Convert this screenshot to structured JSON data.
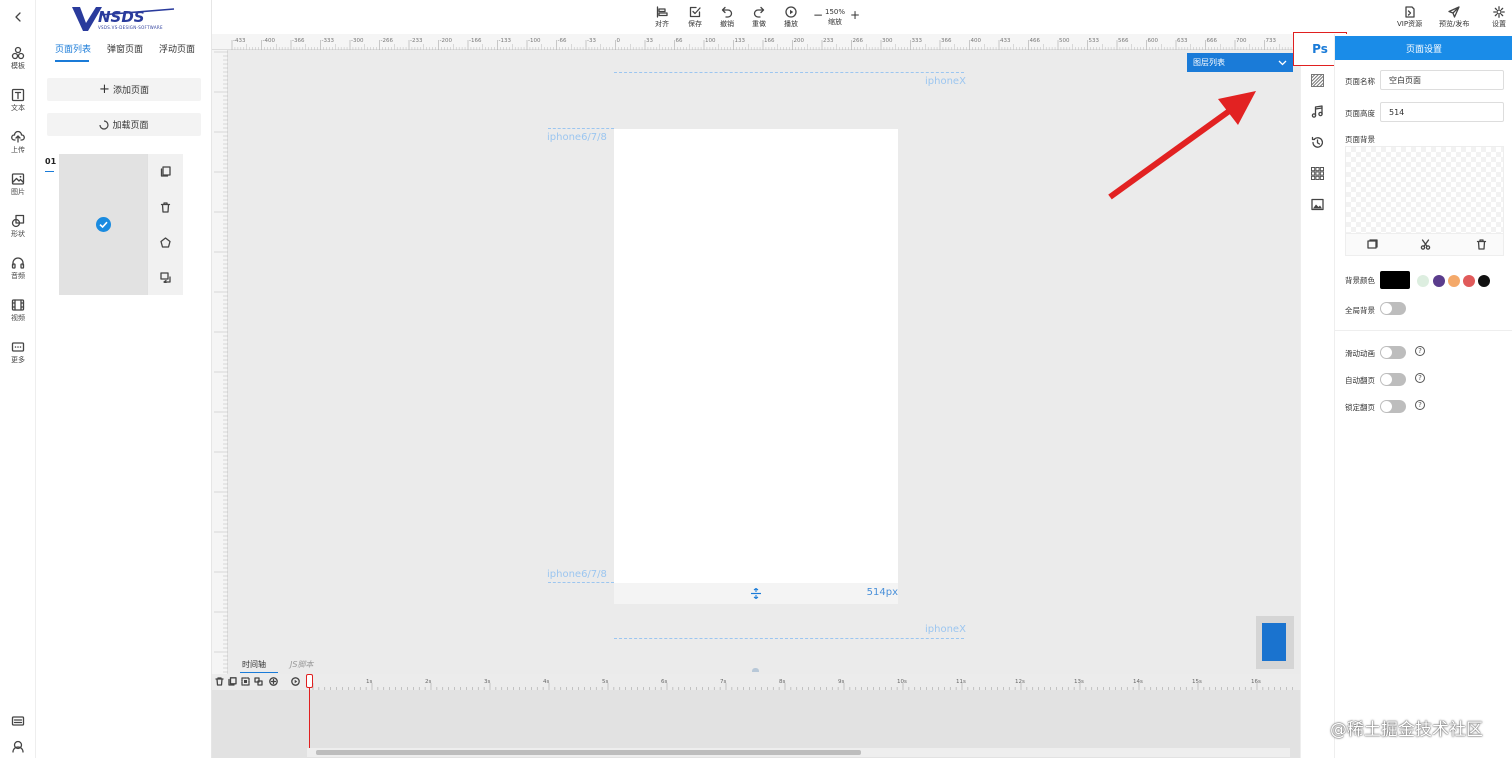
{
  "logo": {
    "text": "VNSDS",
    "subtext": "VSDS.VS-DESIGN-SOFTWARE"
  },
  "left_toolbar": {
    "items": [
      {
        "label": "模板",
        "icon": "template-icon"
      },
      {
        "label": "文本",
        "icon": "text-icon"
      },
      {
        "label": "上传",
        "icon": "upload-icon"
      },
      {
        "label": "图片",
        "icon": "image-icon"
      },
      {
        "label": "形状",
        "icon": "shape-icon"
      },
      {
        "label": "音频",
        "icon": "audio-icon"
      },
      {
        "label": "视频",
        "icon": "video-icon"
      },
      {
        "label": "更多",
        "icon": "more-icon"
      }
    ]
  },
  "page_panel": {
    "tabs": [
      {
        "label": "页面列表",
        "active": true
      },
      {
        "label": "弹窗页面"
      },
      {
        "label": "浮动页面"
      }
    ],
    "add_page": "添加页面",
    "load_page": "加载页面",
    "page_number": "01"
  },
  "toolbar": {
    "align": "对齐",
    "save": "保存",
    "undo": "撤销",
    "redo": "重做",
    "play": "播放",
    "zoom_value": "150%",
    "zoom_label": "缩放",
    "zoom_minus": "−",
    "zoom_plus": "+",
    "vip": "VIP资源",
    "preview": "预览/发布",
    "settings": "设置"
  },
  "ruler": {
    "top_labels": [
      "-433",
      "-400",
      "-366",
      "-333",
      "-300",
      "-266",
      "-233",
      "-200",
      "-166",
      "-133",
      "-100",
      "-66",
      "-33",
      "0",
      "33",
      "66",
      "100",
      "133",
      "166",
      "200",
      "233",
      "266",
      "300",
      "333",
      "366",
      "400",
      "433",
      "466",
      "500",
      "533",
      "566",
      "600",
      "633",
      "666",
      "700",
      "733",
      "76"
    ]
  },
  "canvas": {
    "guide_top": "iphoneX",
    "guide_mid_top": "iphone6/7/8",
    "guide_mid_bottom": "iphone6/7/8",
    "guide_bottom": "iphoneX",
    "height_label": "514px",
    "layer_list": "图层列表"
  },
  "timeline": {
    "tab_timeline": "时间轴",
    "tab_js": "JS脚本",
    "ticks": [
      "1s",
      "2s",
      "3s",
      "4s",
      "5s",
      "6s",
      "7s",
      "8s",
      "9s",
      "10s",
      "11s",
      "12s",
      "13s",
      "14s",
      "15s",
      "16s"
    ]
  },
  "right_strip": {
    "ps": "Ps"
  },
  "settings": {
    "header": "页面设置",
    "page_name_label": "页面名称",
    "page_name_value": "空白页面",
    "page_height_label": "页面高度",
    "page_height_value": "514",
    "page_bg_label": "页面背景",
    "bg_color_label": "背景颜色",
    "global_bg_label": "全局背景",
    "slide_anim_label": "滑动动画",
    "auto_flip_label": "自动翻页",
    "lock_flip_label": "锁定翻页",
    "swatches": [
      "#000000",
      "#ddeee0",
      "#5a3c8c",
      "#f4a96a",
      "#e05a5a",
      "#111111"
    ],
    "accent": "#1a7bd8"
  },
  "watermark": "@稀土掘金技术社区"
}
